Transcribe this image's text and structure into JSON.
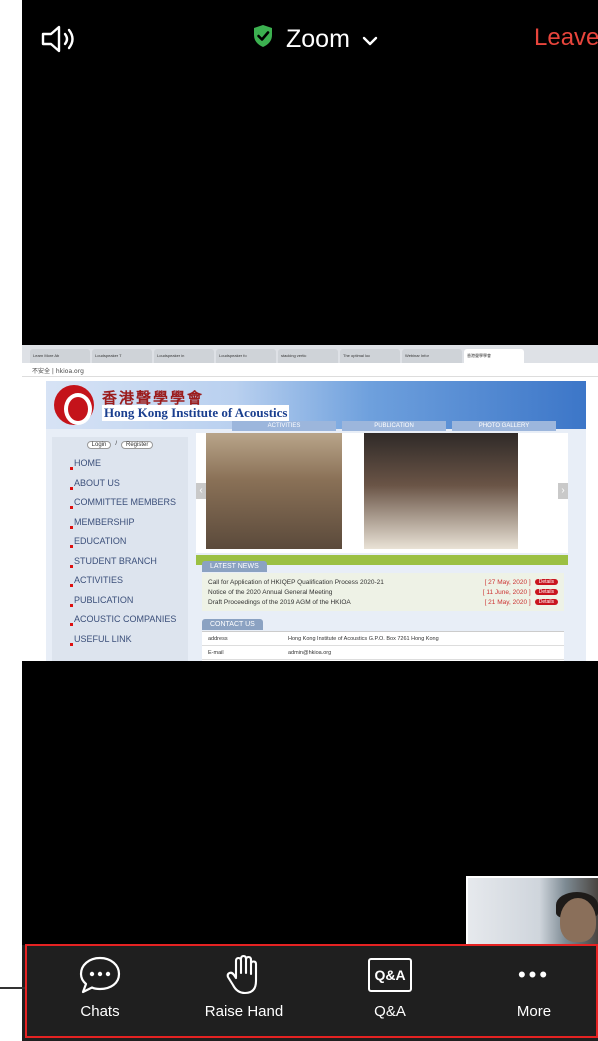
{
  "top_bar": {
    "title": "Zoom",
    "leave_label": "Leave",
    "shield_color": "#3cb050",
    "leave_color": "#e8453c"
  },
  "shared_screen": {
    "browser_tabs": [
      "Learn More Ab",
      "Loudspeaker T",
      "Loudspeaker in",
      "Loudspeaker fo",
      "stacking vertic",
      "The optimal loc",
      "Webinar Infor",
      "香港聲學學會"
    ],
    "address": "不安全 | hkioa.org",
    "site": {
      "title_cn": "香港聲學學會",
      "title_en": "Hong Kong Institute of Acoustics",
      "top_nav": [
        "ACTIVITIES",
        "PUBLICATION",
        "PHOTO GALLERY"
      ],
      "login": "Login",
      "register": "Register",
      "nav": [
        "HOME",
        "ABOUT US",
        "COMMITTEE MEMBERS",
        "MEMBERSHIP",
        "EDUCATION",
        "STUDENT BRANCH",
        "ACTIVITIES",
        "PUBLICATION",
        "ACOUSTIC COMPANIES",
        "USEFUL LINK"
      ],
      "latest_news_label": "LATEST NEWS",
      "news": [
        {
          "title": "Call for Application of HKIQEP Qualification Process 2020-21",
          "date": "[ 27 May, 2020 ]",
          "action": "Details"
        },
        {
          "title": "Notice of the 2020 Annual General Meeting",
          "date": "[ 11 June, 2020 ]",
          "action": "Details"
        },
        {
          "title": "Draft Proceedings of the 2019 AGM of the HKIOA",
          "date": "[ 21 May, 2020 ]",
          "action": "Details"
        }
      ],
      "contact_label": "CONTACT US",
      "contact": [
        {
          "key": "address",
          "value": "Hong Kong Institute of Acoustics G.P.O. Box 7261 Hong Kong"
        },
        {
          "key": "E-mail",
          "value": "admin@hkioa.org"
        }
      ]
    }
  },
  "toolbar": {
    "chats": "Chats",
    "raise_hand": "Raise Hand",
    "qa_icon_text": "Q&A",
    "qa": "Q&A",
    "more_icon_text": "•••",
    "more": "More"
  },
  "annotation": {
    "box_color": "#e52222"
  }
}
